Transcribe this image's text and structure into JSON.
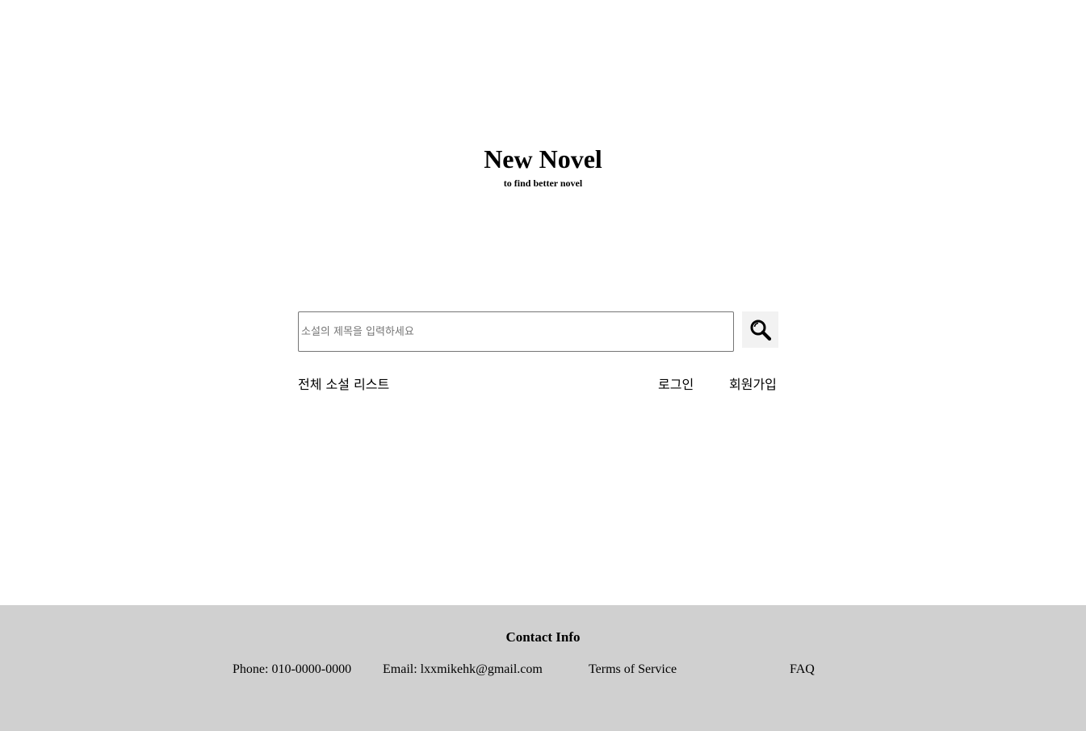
{
  "header": {
    "title": "New Novel",
    "subtitle": "to find better novel"
  },
  "search": {
    "placeholder": "소설의 제목을 입력하세요",
    "value": "",
    "button_icon": "search-icon"
  },
  "nav": {
    "all_novels": "전체 소설 리스트",
    "login": "로그인",
    "signup": "회원가입"
  },
  "footer": {
    "title": "Contact Info",
    "phone": "Phone: 010-0000-0000",
    "email": "Email: lxxmikehk@gmail.com",
    "terms": "Terms of Service",
    "faq": "FAQ",
    "background_color": "#d0d0d0"
  }
}
